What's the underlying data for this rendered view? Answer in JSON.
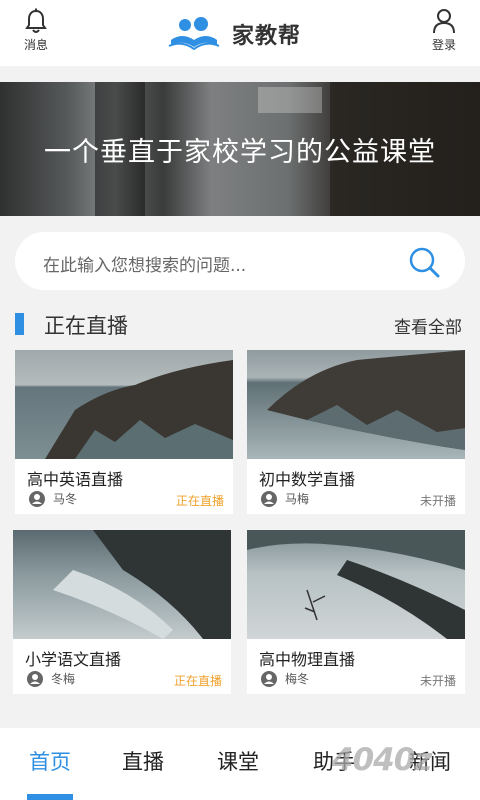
{
  "header": {
    "message_label": "消息",
    "login_label": "登录",
    "brand_name": "家教帮"
  },
  "banner": {
    "title": "一个垂直于家校学习的公益课堂"
  },
  "search": {
    "placeholder": "在此输入您想搜索的问题..."
  },
  "live_section": {
    "title": "正在直播",
    "see_all": "查看全部",
    "courses": [
      {
        "name": "高中英语直播",
        "teacher": "马冬",
        "status": "正在直播"
      },
      {
        "name": "初中数学直播",
        "teacher": "马梅",
        "status": "未开播"
      },
      {
        "name": "小学语文直播",
        "teacher": "冬梅",
        "status": "正在直播"
      },
      {
        "name": "高中物理直播",
        "teacher": "梅冬",
        "status": "未开播"
      }
    ]
  },
  "bottom_nav": {
    "tabs": [
      "首页",
      "直播",
      "课堂",
      "助手",
      "新闻"
    ],
    "active": "首页"
  },
  "watermark": "4040z",
  "colors": {
    "accent": "#2e8fe3",
    "live_status": "#f0a12c",
    "idle_status": "#777777"
  }
}
